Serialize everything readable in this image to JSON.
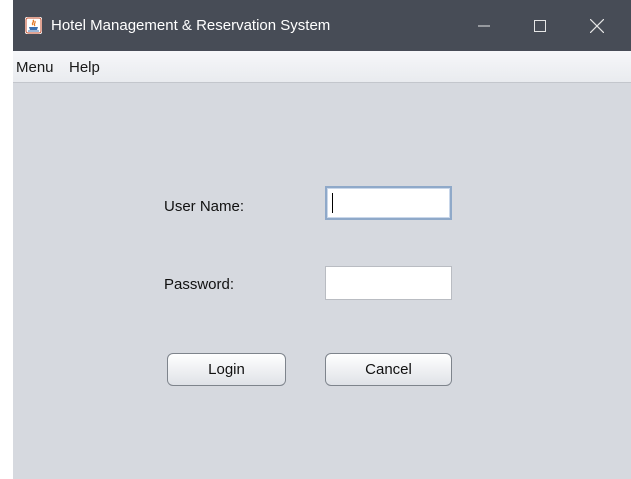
{
  "window": {
    "title": "Hotel Management & Reservation System",
    "controls": {
      "minimize": "minimize-icon",
      "maximize": "maximize-icon",
      "close": "close-icon"
    }
  },
  "menubar": {
    "items": [
      {
        "label": "Menu"
      },
      {
        "label": "Help"
      }
    ]
  },
  "form": {
    "username_label": "User Name:",
    "username_value": "",
    "password_label": "Password:",
    "password_value": "",
    "login_label": "Login",
    "cancel_label": "Cancel"
  },
  "colors": {
    "titlebar": "#474c56",
    "content_bg": "#d6d9df",
    "focus_border": "#8fa9c9"
  }
}
